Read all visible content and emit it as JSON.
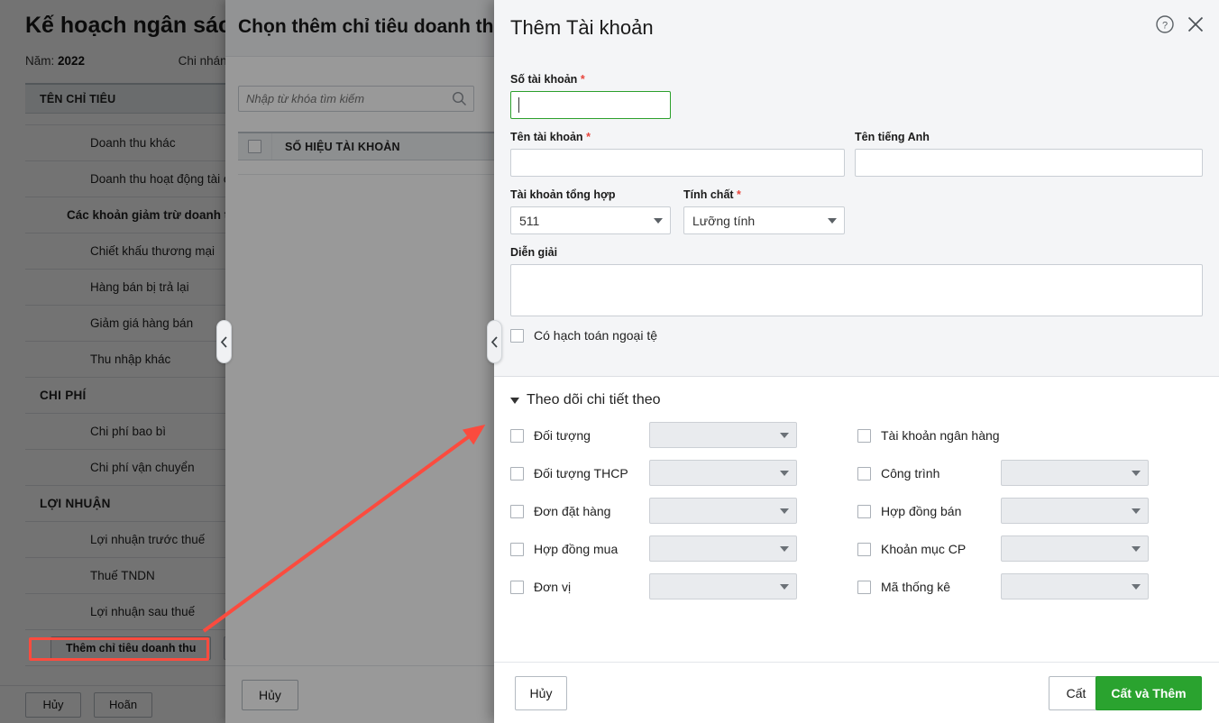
{
  "base_page": {
    "title": "Kế hoạch ngân sách",
    "meta": {
      "year_label": "Năm:",
      "year_value": "2022",
      "branch_label": "Chi nhánh"
    },
    "table": {
      "columns": [
        "TÊN CHỈ TIÊU",
        ""
      ],
      "rows": [
        {
          "label": "Doanh thu khác",
          "level": 2
        },
        {
          "label": "Doanh thu hoạt động tài chính",
          "level": 2
        },
        {
          "label": "Các khoản giảm trừ doanh thu",
          "level": 1
        },
        {
          "label": "Chiết khấu thương mại",
          "level": 2
        },
        {
          "label": "Hàng bán bị trả lại",
          "level": 2
        },
        {
          "label": "Giảm giá hàng bán",
          "level": 2
        },
        {
          "label": "Thu nhập khác",
          "level": 2
        },
        {
          "label": "CHI PHÍ",
          "level": 0
        },
        {
          "label": "Chi phí bao bì",
          "level": 2
        },
        {
          "label": "Chi phí vận chuyển",
          "level": 2
        },
        {
          "label": "LỢI NHUẬN",
          "level": 0
        },
        {
          "label": "Lợi nhuận trước thuế",
          "level": 2
        },
        {
          "label": "Thuế TNDN",
          "level": 2
        },
        {
          "label": "Lợi nhuận sau thuế",
          "level": 2
        }
      ],
      "add_button": "Thêm chỉ tiêu doanh thu"
    },
    "footer": {
      "cancel": "Hủy",
      "postpone": "Hoãn"
    }
  },
  "middle_modal": {
    "title": "Chọn thêm chỉ tiêu doanh thu",
    "search": {
      "placeholder": "Nhập từ khóa tìm kiếm",
      "value": "",
      "icon": "search-icon"
    },
    "table": {
      "columns": [
        "SỐ HIỆU TÀI KHOẢN"
      ]
    },
    "footer": {
      "cancel": "Hủy"
    }
  },
  "top_modal": {
    "title": "Thêm Tài khoản",
    "help_icon": "help-circle-icon",
    "close_icon": "close-icon",
    "required_marker": "*",
    "fields": {
      "account_number": {
        "label": "Số tài khoản",
        "required": true,
        "value": "",
        "focused": true
      },
      "account_name": {
        "label": "Tên tài khoản",
        "required": true,
        "value": ""
      },
      "english_name": {
        "label": "Tên tiếng Anh",
        "required": false,
        "value": ""
      },
      "parent_account": {
        "label": "Tài khoản tổng hợp",
        "required": false,
        "value": "511"
      },
      "nature": {
        "label": "Tính chất",
        "required": true,
        "value": "Lưỡng tính"
      },
      "description": {
        "label": "Diễn giải",
        "required": false,
        "value": ""
      },
      "foreign_currency": {
        "label": "Có hạch toán ngoại tệ",
        "checked": false
      }
    },
    "tracking": {
      "section_title": "Theo dõi chi tiết theo",
      "expanded": true,
      "left_items": [
        {
          "label": "Đối tượng",
          "checked": false,
          "has_dropdown": true,
          "value": ""
        },
        {
          "label": "Đối tượng THCP",
          "checked": false,
          "has_dropdown": true,
          "value": ""
        },
        {
          "label": "Đơn đặt hàng",
          "checked": false,
          "has_dropdown": true,
          "value": ""
        },
        {
          "label": "Hợp đồng mua",
          "checked": false,
          "has_dropdown": true,
          "value": ""
        },
        {
          "label": "Đơn vị",
          "checked": false,
          "has_dropdown": true,
          "value": ""
        }
      ],
      "right_items": [
        {
          "label": "Tài khoản ngân hàng",
          "checked": false,
          "has_dropdown": false,
          "value": ""
        },
        {
          "label": "Công trình",
          "checked": false,
          "has_dropdown": true,
          "value": ""
        },
        {
          "label": "Hợp đồng bán",
          "checked": false,
          "has_dropdown": true,
          "value": ""
        },
        {
          "label": "Khoản mục CP",
          "checked": false,
          "has_dropdown": true,
          "value": ""
        },
        {
          "label": "Mã thống kê",
          "checked": false,
          "has_dropdown": true,
          "value": ""
        }
      ]
    },
    "footer": {
      "cancel": "Hủy",
      "save": "Cất",
      "save_and_add": "Cất và Thêm"
    }
  },
  "annotations": {
    "highlight_color": "#fb4b3e",
    "arrow_color": "#fb4b3e",
    "highlighted_element": "Thêm chỉ tiêu doanh thu"
  },
  "colors": {
    "accent_green": "#2aa32f",
    "focus_green": "#2ca02c",
    "required_red": "#e8453c",
    "panel_bg": "#f4f5f7",
    "annotation_red": "#fb4b3e"
  }
}
